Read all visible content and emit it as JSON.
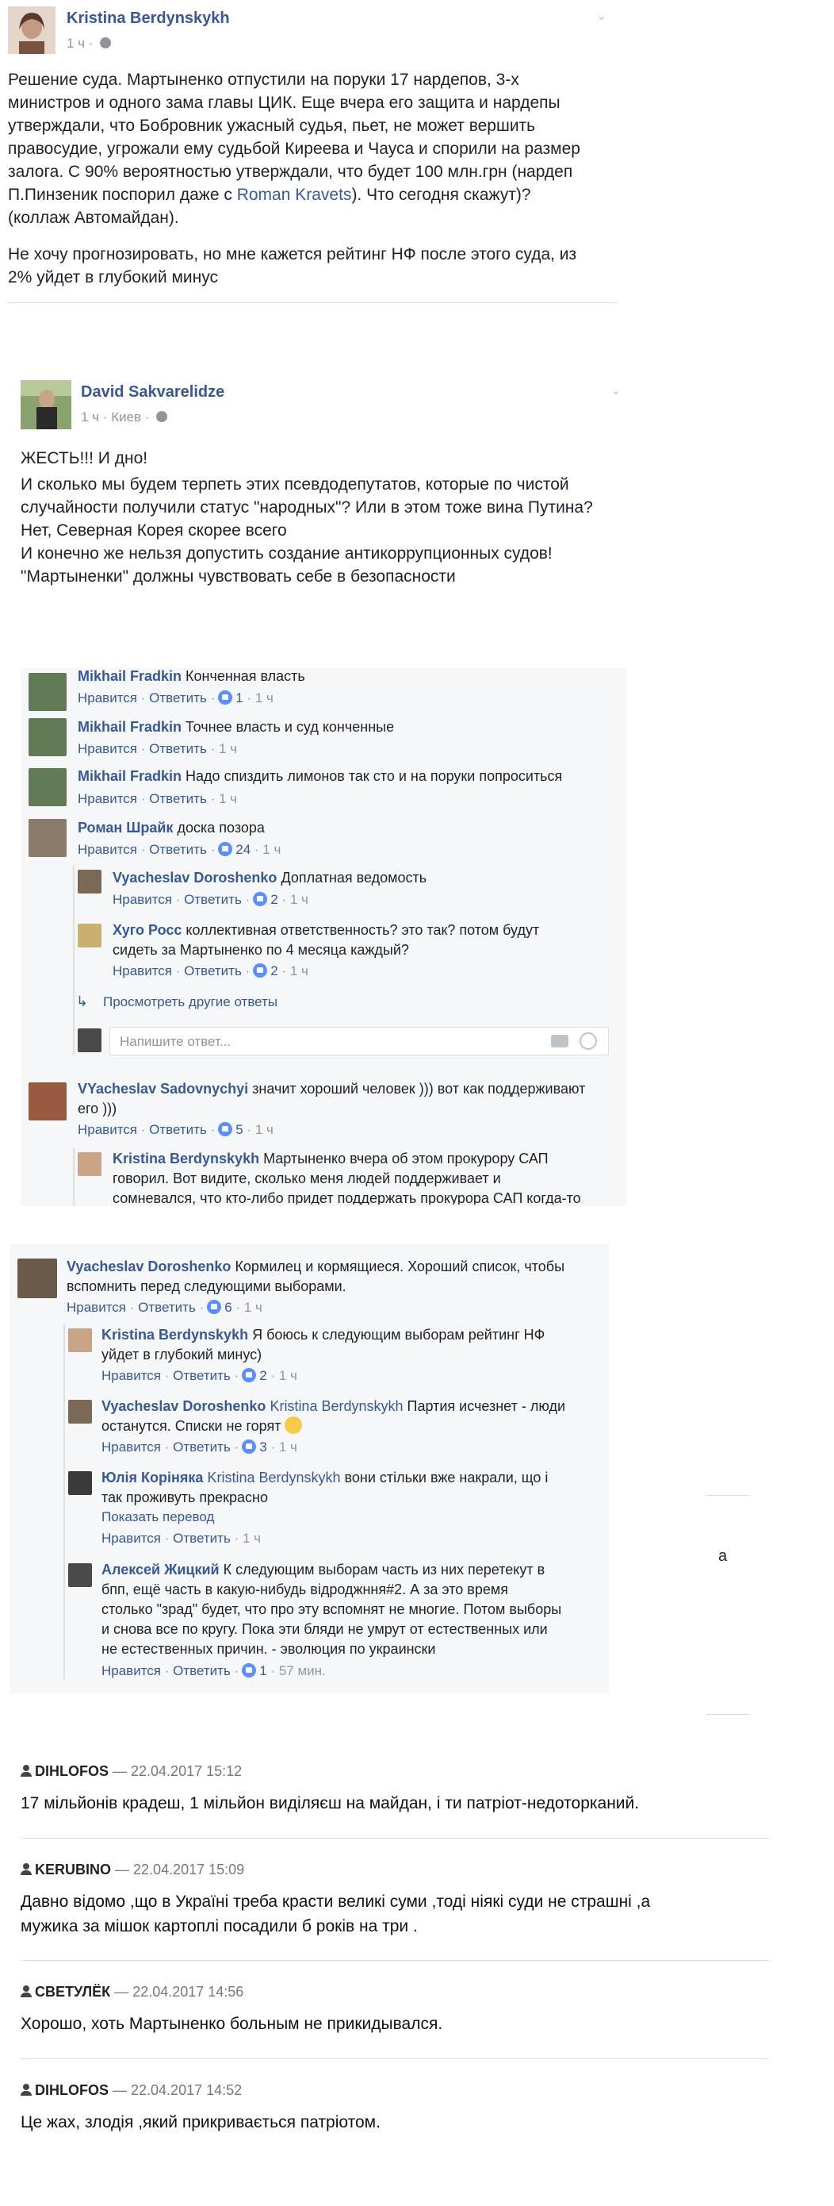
{
  "post1": {
    "author": "Kristina Berdynskykh",
    "time": "1 ч",
    "text": [
      "Решение суда. Мартыненко отпустили на поруки 17 нардепов, 3-х",
      "министров и одного зама главы ЦИК. Еще вчера его защита и нардепы",
      "утверждали, что Бобровник ужасный судья, пьет, не может вершить",
      "правосудие, угрожали ему судьбой Киреева и Чауса и спорили на размер",
      "залога. С 90% вероятностью утверждали, что будет 100 млн.грн (нардеп"
    ],
    "line6_before": "П.Пинзеник поспорил даже с ",
    "line6_link": "Roman Kravets",
    "line6_after": "). Что сегодня скажут)?",
    "line7": "(коллаж Автомайдан).",
    "text2": [
      "Не хочу прогнозировать, но мне кажется рейтинг НФ после этого суда, из",
      "2% уйдет в глубокий минус"
    ]
  },
  "post2": {
    "author": "David Sakvarelidze",
    "time": "1 ч",
    "location": "Киев",
    "text": [
      "ЖЕСТЬ!!! И дно!",
      "И сколько мы будем терпеть этих псевдодепутатов, которые по чистой",
      "случайности получили статус \"народных\"? Или в этом тоже вина Путина?",
      "Нет, Северная Корея скорее всего",
      "И конечно же нельзя допустить создание антикоррупционных судов!",
      "\"Мартыненки\" должны чувствовать себе в безопасности"
    ]
  },
  "actions": {
    "like": "Нравится",
    "reply": "Ответить",
    "dot": "·"
  },
  "comments1": [
    {
      "name": "Mikhail Fradkin",
      "text": "Конченная власть",
      "likes": "1",
      "time": "1 ч"
    },
    {
      "name": "Mikhail Fradkin",
      "text": "Точнее власть и суд конченные",
      "likes": "",
      "time": "1 ч"
    },
    {
      "name": "Mikhail Fradkin",
      "text": "Надо спиздить лимонов так сто и на поруки попроситься",
      "likes": "",
      "time": "1 ч"
    },
    {
      "name": "Роман Шрайк",
      "text": "доска позора",
      "likes": "24",
      "time": "1 ч"
    }
  ],
  "replies1": [
    {
      "name": "Vyacheslav Doroshenko",
      "text": "Доплатная ведомость",
      "likes": "2",
      "time": "1 ч"
    },
    {
      "name": "Хуго Росс",
      "text1": "коллективная ответственность? это так? потом будут",
      "text2": "сидеть за Мартыненко по 4 месяца каждый?",
      "likes": "2",
      "time": "1 ч"
    }
  ],
  "more_replies": "Просмотреть другие ответы",
  "reply_placeholder": "Напишите ответ...",
  "comment_vs": {
    "name": "VYacheslav Sadovnychyi",
    "text1": "значит хороший человек ))) вот как поддерживают",
    "text2": "его )))",
    "likes": "5",
    "time": "1 ч"
  },
  "reply_kb": {
    "name": "Kristina Berdynskykh",
    "text1": "Мартыненко вчера об этом прокурору САП",
    "text2": "говорил. Вот видите, сколько меня людей поддерживает и",
    "text3": "сомневался, что кто-либо придет поддержать прокурора САП когда-то"
  },
  "panel2": {
    "main": {
      "name": "Vyacheslav Doroshenko",
      "text1": "Кормилец и кормящиеся. Хороший список, чтобы",
      "text2": "вспомнить перед следующими выборами.",
      "likes": "6",
      "time": "1 ч"
    },
    "replies": [
      {
        "name": "Kristina Berdynskykh",
        "text1": "Я боюсь к следующим выборам рейтинг НФ",
        "text2": "уйдет в глубокий минус)",
        "likes": "2",
        "time": "1 ч"
      },
      {
        "name": "Vyacheslav Doroshenko",
        "mention": "Kristina Berdynskykh",
        "text1": "Партия исчезнет - люди",
        "text2": "останутся. Списки не горят",
        "likes": "3",
        "time": "1 ч"
      },
      {
        "name": "Юлія Коріняка",
        "mention": "Kristina Berdynskykh",
        "text1": "вони стільки вже накрали, що і",
        "text2": "так проживуть прекрасно",
        "translate": "Показать перевод",
        "likes": "",
        "time": "1 ч"
      },
      {
        "name": "Алексей Жицкий",
        "text1": "К следующим выборам часть из них перетекут в",
        "text2": "бпп, ещё часть в какую-нибудь відроджння#2. А за это время",
        "text3": "столько \"зрад\" будет, что про эту вспомнят не многие. Потом выборы",
        "text4": "и снова все по кругу. Пока эти бляди не умрут от естественных или",
        "text5": "не естественных причин. - эволюция по украински",
        "likes": "1",
        "time": "57 мин."
      }
    ]
  },
  "site_comments": [
    {
      "user": "DIHLOFOS",
      "date": "— 22.04.2017 15:12",
      "text": [
        "17 мільйонів крадеш, 1 мільйон виділяєш на майдан, і ти патріот-недоторканий."
      ]
    },
    {
      "user": "KERUBINO",
      "date": "— 22.04.2017 15:09",
      "text": [
        "Давно відомо ,що в Україні треба красти великі суми ,тоді ніякі суди не страшні ,а",
        "мужика за мішок картоплі посадили б років на три ."
      ]
    },
    {
      "user": "СВЕТУЛЁК",
      "date": "— 22.04.2017 14:56",
      "text": [
        "Хорошо, хоть Мартыненко больным не прикидывался."
      ]
    },
    {
      "user": "DIHLOFOS",
      "date": "— 22.04.2017 14:52",
      "text": [
        "Це жах, злодія ,який прикривається патріотом."
      ]
    }
  ],
  "stray_char": "а"
}
